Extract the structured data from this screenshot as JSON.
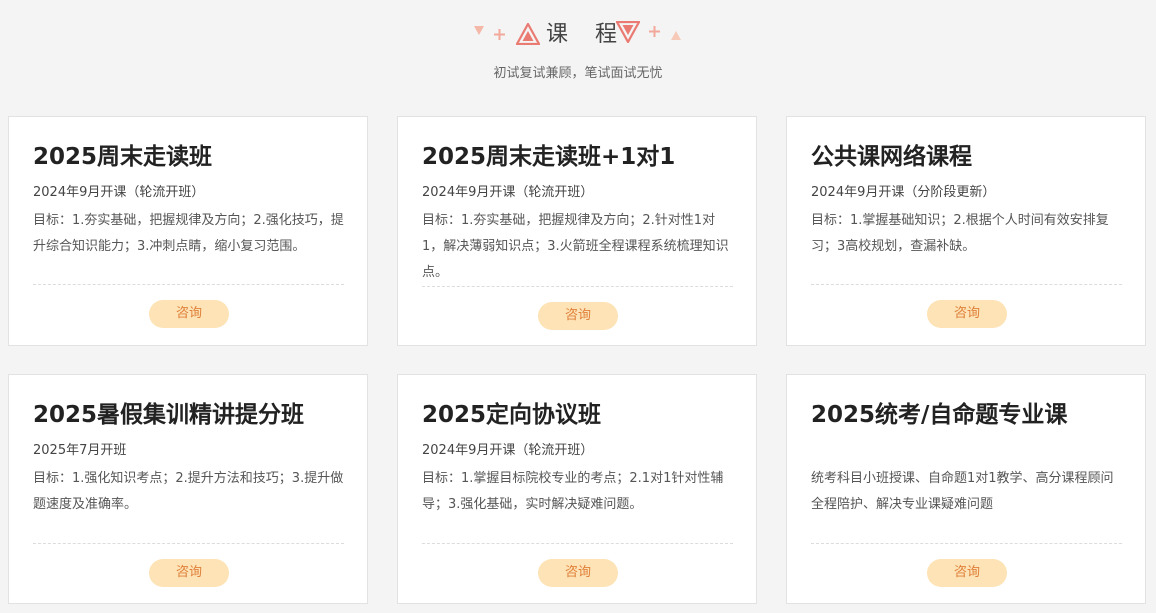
{
  "header": {
    "title": "课 程",
    "subtitle": "初试复试兼顾，笔试面试无忧"
  },
  "colors": {
    "accent": "#ea7b73",
    "button_bg": "#fde3b5",
    "button_text": "#e0803a",
    "background": "#f4f4f4"
  },
  "cards": [
    {
      "title": "2025周末走读班",
      "date": "2024年9月开课（轮流开班）",
      "desc": "目标：1.夯实基础，把握规律及方向；2.强化技巧，提升综合知识能力；3.冲刺点睛，缩小复习范围。",
      "button": "咨询"
    },
    {
      "title": "2025周末走读班+1对1",
      "date": "2024年9月开课（轮流开班）",
      "desc": "目标：1.夯实基础，把握规律及方向；2.针对性1对1，解决薄弱知识点；3.火箭班全程课程系统梳理知识点。",
      "button": "咨询"
    },
    {
      "title": "公共课网络课程",
      "date": "2024年9月开课（分阶段更新）",
      "desc": "目标：1.掌握基础知识；2.根据个人时间有效安排复习；3高校规划，查漏补缺。",
      "button": "咨询"
    },
    {
      "title": "2025暑假集训精讲提分班",
      "date": "2025年7月开班",
      "desc": "目标：1.强化知识考点；2.提升方法和技巧；3.提升做题速度及准确率。",
      "button": "咨询"
    },
    {
      "title": "2025定向协议班",
      "date": "2024年9月开课（轮流开班）",
      "desc": "目标：1.掌握目标院校专业的考点；2.1对1针对性辅导；3.强化基础，实时解决疑难问题。",
      "button": "咨询"
    },
    {
      "title": "2025统考/自命题专业课",
      "date": "",
      "desc": "统考科目小班授课、自命题1对1教学、高分课程顾问全程陪护、解决专业课疑难问题",
      "button": "咨询"
    }
  ]
}
